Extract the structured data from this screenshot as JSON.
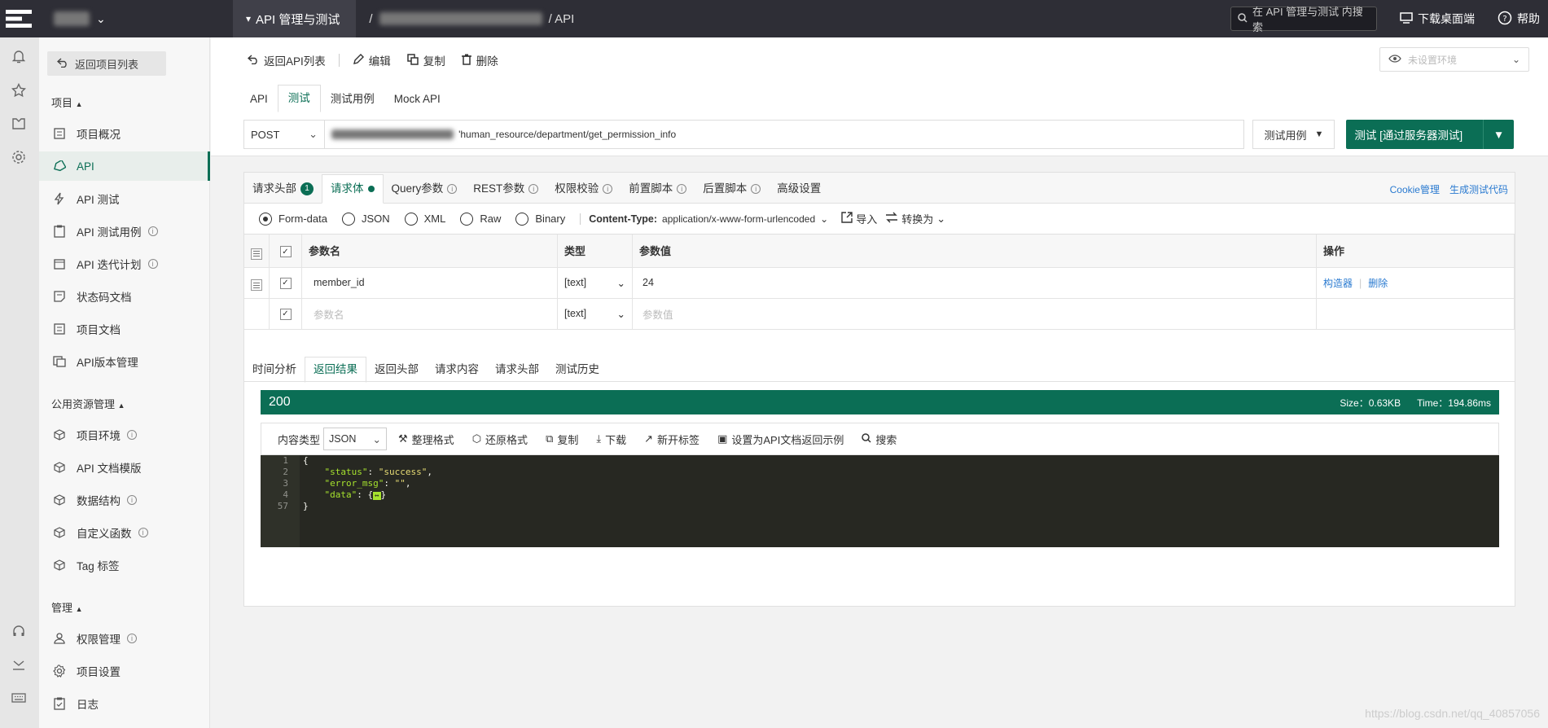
{
  "topbar": {
    "project_name": "API 管理与测试",
    "breadcrumb_sep": "/",
    "breadcrumb_last": "/ API",
    "search_placeholder": "在 API 管理与测试 内搜索",
    "download_label": "下载桌面端",
    "help_label": "帮助"
  },
  "sidebar": {
    "back_label": "返回项目列表",
    "section_project": "项目",
    "section_public": "公用资源管理",
    "section_manage": "管理",
    "items": [
      {
        "label": "项目概况",
        "icon": "overview-icon"
      },
      {
        "label": "API",
        "icon": "api-tag-icon"
      },
      {
        "label": "API 测试",
        "icon": "bolt-icon"
      },
      {
        "label": "API 测试用例",
        "icon": "case-icon"
      },
      {
        "label": "API 迭代计划",
        "icon": "calendar-icon"
      },
      {
        "label": "状态码文档",
        "icon": "doc-icon"
      },
      {
        "label": "项目文档",
        "icon": "doc2-icon"
      },
      {
        "label": "API版本管理",
        "icon": "version-icon"
      },
      {
        "label": "项目环境",
        "icon": "cube-icon"
      },
      {
        "label": "API 文档模版",
        "icon": "cube-icon"
      },
      {
        "label": "数据结构",
        "icon": "cube-icon"
      },
      {
        "label": "自定义函数",
        "icon": "cube-icon"
      },
      {
        "label": "Tag 标签",
        "icon": "cube-icon"
      },
      {
        "label": "权限管理",
        "icon": "user-icon"
      },
      {
        "label": "项目设置",
        "icon": "gear-icon"
      },
      {
        "label": "日志",
        "icon": "log-icon"
      }
    ]
  },
  "toolbar": {
    "back": "返回API列表",
    "edit": "编辑",
    "copy": "复制",
    "delete": "删除",
    "env_placeholder": "未设置环境"
  },
  "api_tabs": [
    "API",
    "测试",
    "测试用例",
    "Mock API"
  ],
  "request": {
    "method": "POST",
    "url_path": "'human_resource/department/get_permission_info",
    "case_label": "测试用例",
    "test_button": "测试 [通过服务器测试]"
  },
  "req_tabs": [
    {
      "label": "请求头部",
      "badge": "1"
    },
    {
      "label": "请求体"
    },
    {
      "label": "Query参数"
    },
    {
      "label": "REST参数"
    },
    {
      "label": "权限校验"
    },
    {
      "label": "前置脚本"
    },
    {
      "label": "后置脚本"
    },
    {
      "label": "高级设置"
    }
  ],
  "req_links": [
    "Cookie管理",
    "生成测试代码"
  ],
  "body_types": [
    "Form-data",
    "JSON",
    "XML",
    "Raw",
    "Binary"
  ],
  "content_type_label": "Content-Type:",
  "content_type_value": "application/x-www-form-urlencoded",
  "import_label": "导入",
  "convert_label": "转换为",
  "params_table": {
    "headers": [
      "参数名",
      "类型",
      "参数值",
      "操作"
    ],
    "rows": [
      {
        "name": "member_id",
        "type": "[text]",
        "value": "24",
        "op1": "构造器",
        "op2": "删除"
      }
    ],
    "new_row": {
      "name_ph": "参数名",
      "type": "[text]",
      "value_ph": "参数值"
    }
  },
  "res_tabs": [
    "时间分析",
    "返回结果",
    "返回头部",
    "请求内容",
    "请求头部",
    "测试历史"
  ],
  "response": {
    "status": "200",
    "size": "Size：0.63KB",
    "time": "Time：194.86ms",
    "content_type_label": "内容类型",
    "content_type": "JSON",
    "actions": [
      "整理格式",
      "还原格式",
      "复制",
      "下载",
      "新开标签",
      "设置为API文档返回示例",
      "搜索"
    ],
    "line_numbers": [
      "1",
      "2",
      "3",
      "4",
      "57"
    ],
    "code": {
      "open": "{",
      "k1": "\"status\"",
      "v1": "\"success\"",
      "k2": "\"error_msg\"",
      "v2": "\"\"",
      "k3": "\"data\"",
      "fold": "↔",
      "close": "}"
    }
  },
  "watermark": "https://blog.csdn.net/qq_40857056"
}
